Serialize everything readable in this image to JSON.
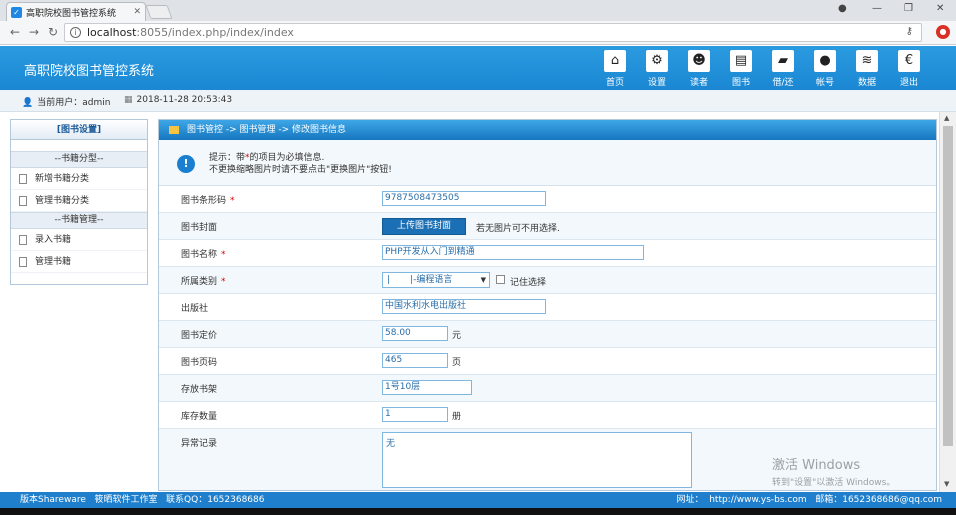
{
  "browser": {
    "tab_title": "高职院校图书管控系统",
    "url_host": "localhost",
    "url_path": ":8055/index.php/index/index"
  },
  "header": {
    "title": "高职院校图书管控系统",
    "nav": [
      {
        "label": "首页",
        "icon": "home-icon",
        "glyph": "⌂"
      },
      {
        "label": "设置",
        "icon": "settings-icon",
        "glyph": "⚙"
      },
      {
        "label": "读者",
        "icon": "readers-icon",
        "glyph": "☻"
      },
      {
        "label": "图书",
        "icon": "book-icon",
        "glyph": "▤"
      },
      {
        "label": "借/还",
        "icon": "folder-icon",
        "glyph": "▰"
      },
      {
        "label": "帐号",
        "icon": "account-icon",
        "glyph": "●"
      },
      {
        "label": "数据",
        "icon": "database-icon",
        "glyph": "≋"
      },
      {
        "label": "退出",
        "icon": "logout-icon",
        "glyph": "€"
      }
    ]
  },
  "info_bar": {
    "current_user": "当前用户：admin",
    "datetime": "2018-11-28 20:53:43"
  },
  "sidebar": {
    "title": "[图书设置]",
    "groups": [
      {
        "title": "--书籍分型--",
        "items": [
          "新增书籍分类",
          "管理书籍分类"
        ]
      },
      {
        "title": "--书籍管理--",
        "items": [
          "录入书籍",
          "管理书籍"
        ]
      }
    ]
  },
  "main": {
    "breadcrumb": "图书管控 -> 图书管理 -> 修改图书信息",
    "tips_line1_a": "提示：带",
    "tips_star": "*",
    "tips_line1_b": "的项目为必填信息.",
    "tips_line2": "不更换缩略图片时请不要点击\"更换图片\"按钮!",
    "form": {
      "barcode_label": "图书条形码",
      "barcode_value": "9787508473505",
      "cover_label": "图书封面",
      "cover_button": "上传图书封面",
      "cover_hint": "若无图片可不用选择.",
      "name_label": "图书名称",
      "name_value": "PHP开发从入门到精通",
      "category_label": "所属类别",
      "category_value": "|       |-编程语言",
      "remember_label": "记住选择",
      "publisher_label": "出版社",
      "publisher_value": "中国水利水电出版社",
      "price_label": "图书定价",
      "price_value": "58.00",
      "price_unit": "元",
      "pages_label": "图书页码",
      "pages_value": "465",
      "pages_unit": "页",
      "shelf_label": "存放书架",
      "shelf_value": "1号10层",
      "stock_label": "库存数量",
      "stock_value": "1",
      "stock_unit": "册",
      "abnormal_label": "异常记录",
      "abnormal_value": "无",
      "required_mark": "*"
    }
  },
  "footer": {
    "left": "版本Shareware   筱晒软件工作室   联系QQ：1652368686",
    "right": "网址：  http://www.ys-bs.com   邮箱：1652368686@qq.com"
  },
  "watermark": {
    "line1": "激活 Windows",
    "line2": "转到\"设置\"以激活 Windows。"
  }
}
